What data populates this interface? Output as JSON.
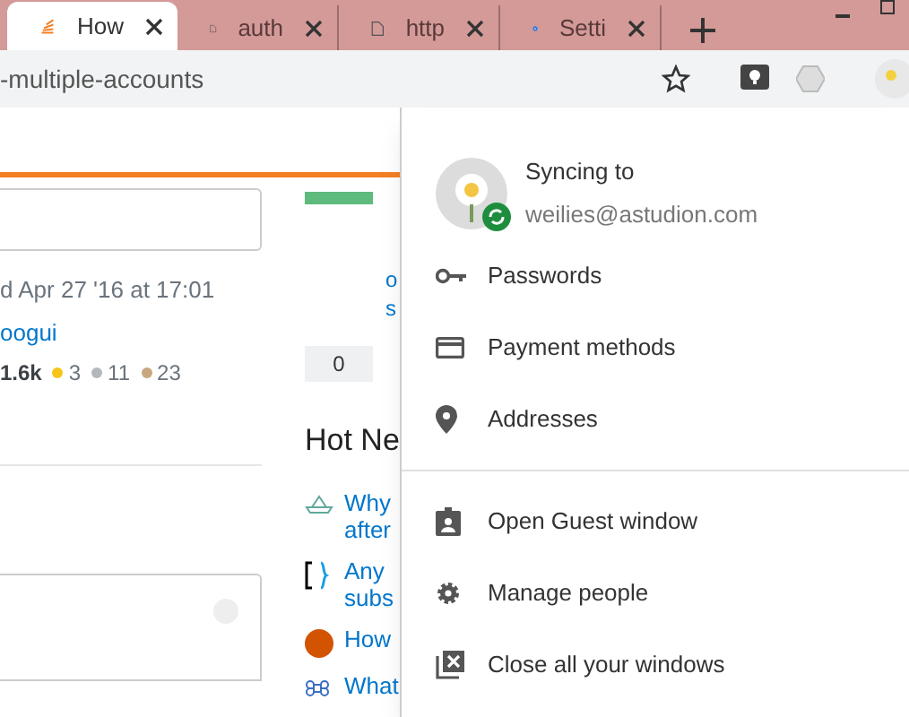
{
  "tabs": [
    {
      "label": "How",
      "selected": true
    },
    {
      "label": "auth",
      "selected": false
    },
    {
      "label": "http",
      "selected": false
    },
    {
      "label": "Setti",
      "selected": false
    }
  ],
  "address_bar": {
    "url": "-multiple-accounts"
  },
  "page": {
    "post_date": "d Apr 27 '16 at 17:01",
    "user": "oogui",
    "reputation": "1.6k",
    "badges": [
      {
        "count": "3",
        "color": "#f5c518"
      },
      {
        "count": "11",
        "color": "#b4b8bc"
      },
      {
        "count": "23",
        "color": "#c9a880"
      }
    ],
    "sidebar_links": [
      "o",
      "s"
    ],
    "vote_count": "0",
    "hot_title": "Hot Ne",
    "hot_items": [
      {
        "lines": [
          "Why",
          "after"
        ]
      },
      {
        "lines": [
          "Any",
          "subs"
        ]
      },
      {
        "lines": [
          "How"
        ]
      },
      {
        "lines": [
          "What"
        ]
      }
    ]
  },
  "profile_menu": {
    "status": "Syncing to",
    "email": "weilies@astudion.com",
    "groups": [
      [
        {
          "label": "Passwords"
        },
        {
          "label": "Payment methods"
        },
        {
          "label": "Addresses"
        }
      ],
      [
        {
          "label": "Open Guest window"
        },
        {
          "label": "Manage people"
        },
        {
          "label": "Close all your windows"
        }
      ]
    ]
  }
}
